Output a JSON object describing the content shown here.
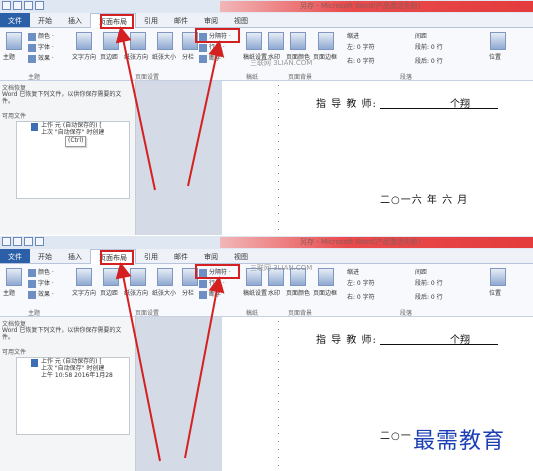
{
  "app": {
    "title_text": "另存 - Microsoft Word(产品激活失败)",
    "tabs": [
      "文件",
      "开始",
      "插入",
      "页面布局",
      "引用",
      "邮件",
      "审阅",
      "视图"
    ],
    "watermark_site": "三联网 3LIAN.COM"
  },
  "ribbon": {
    "theme": [
      "主题",
      "颜色 ·",
      "字体 ·",
      "效果 ·"
    ],
    "group_theme": "主题",
    "page_setup": [
      "文字方向",
      "页边距",
      "纸张方向",
      "纸张大小",
      "分栏"
    ],
    "breaks": "分隔符 ·",
    "line_numbers": "行号 ·",
    "hyphenation": "断字 ·",
    "group_page_setup": "页面设置",
    "background": [
      "稿纸设置",
      "水印",
      "页面颜色",
      "页面边框"
    ],
    "group_draft": "稿纸",
    "group_background": "页面背景",
    "indent_label": "缩进",
    "spacing_label": "间距",
    "indent_left": "左: 0 字符",
    "indent_right": "右: 0 字符",
    "spacing_before": "段前: 0 行",
    "spacing_after": "段后: 0 行",
    "group_paragraph": "段落",
    "position": "位置"
  },
  "nav": {
    "title": "文档恢复",
    "path": "Word 已恢复下列文件，以供你保存需要的文件。",
    "subtitle": "可用文件",
    "item_title": "上作 元 (自动保存的) [",
    "item_sub1": "上次 \"自动保存\" 时创建",
    "item_time": "上午 10:58 2016年1月28",
    "ctrl_label": "(Ctrl)"
  },
  "document": {
    "teacher_label": "指 导 教 师:",
    "teacher_name": "个翔",
    "date_text": "二○一六 年 六 月",
    "date_text_partial": "二○一"
  },
  "watermark_brand": "最需教育"
}
